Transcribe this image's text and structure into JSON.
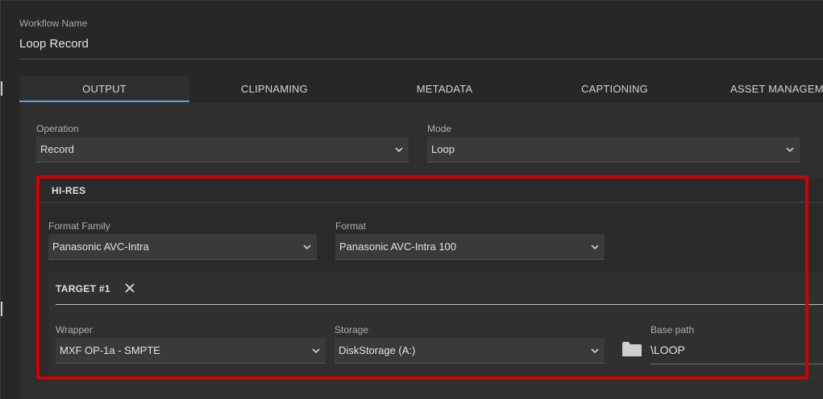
{
  "workflow": {
    "label": "Workflow Name",
    "value": "Loop Record"
  },
  "tabs": [
    {
      "label": "OUTPUT",
      "active": true
    },
    {
      "label": "CLIPNAMING"
    },
    {
      "label": "METADATA"
    },
    {
      "label": "CAPTIONING"
    },
    {
      "label": "ASSET MANAGEME"
    }
  ],
  "operation": {
    "label": "Operation",
    "value": "Record"
  },
  "mode": {
    "label": "Mode",
    "value": "Loop"
  },
  "hires": {
    "title": "HI-RES",
    "format_family": {
      "label": "Format Family",
      "value": "Panasonic AVC-Intra"
    },
    "format": {
      "label": "Format",
      "value": "Panasonic AVC-Intra 100"
    },
    "target": {
      "title": "TARGET #1",
      "wrapper": {
        "label": "Wrapper",
        "value": "MXF OP-1a - SMPTE"
      },
      "storage": {
        "label": "Storage",
        "value": "DiskStorage (A:)"
      },
      "base_path": {
        "label": "Base path",
        "value": "\\LOOP"
      }
    }
  },
  "icons": {
    "dropdown": "chevron-down-icon",
    "close": "close-icon",
    "folder": "folder-icon"
  },
  "colors": {
    "accent": "#5aa9e6",
    "highlight": "#d40000",
    "background": "#272727"
  }
}
